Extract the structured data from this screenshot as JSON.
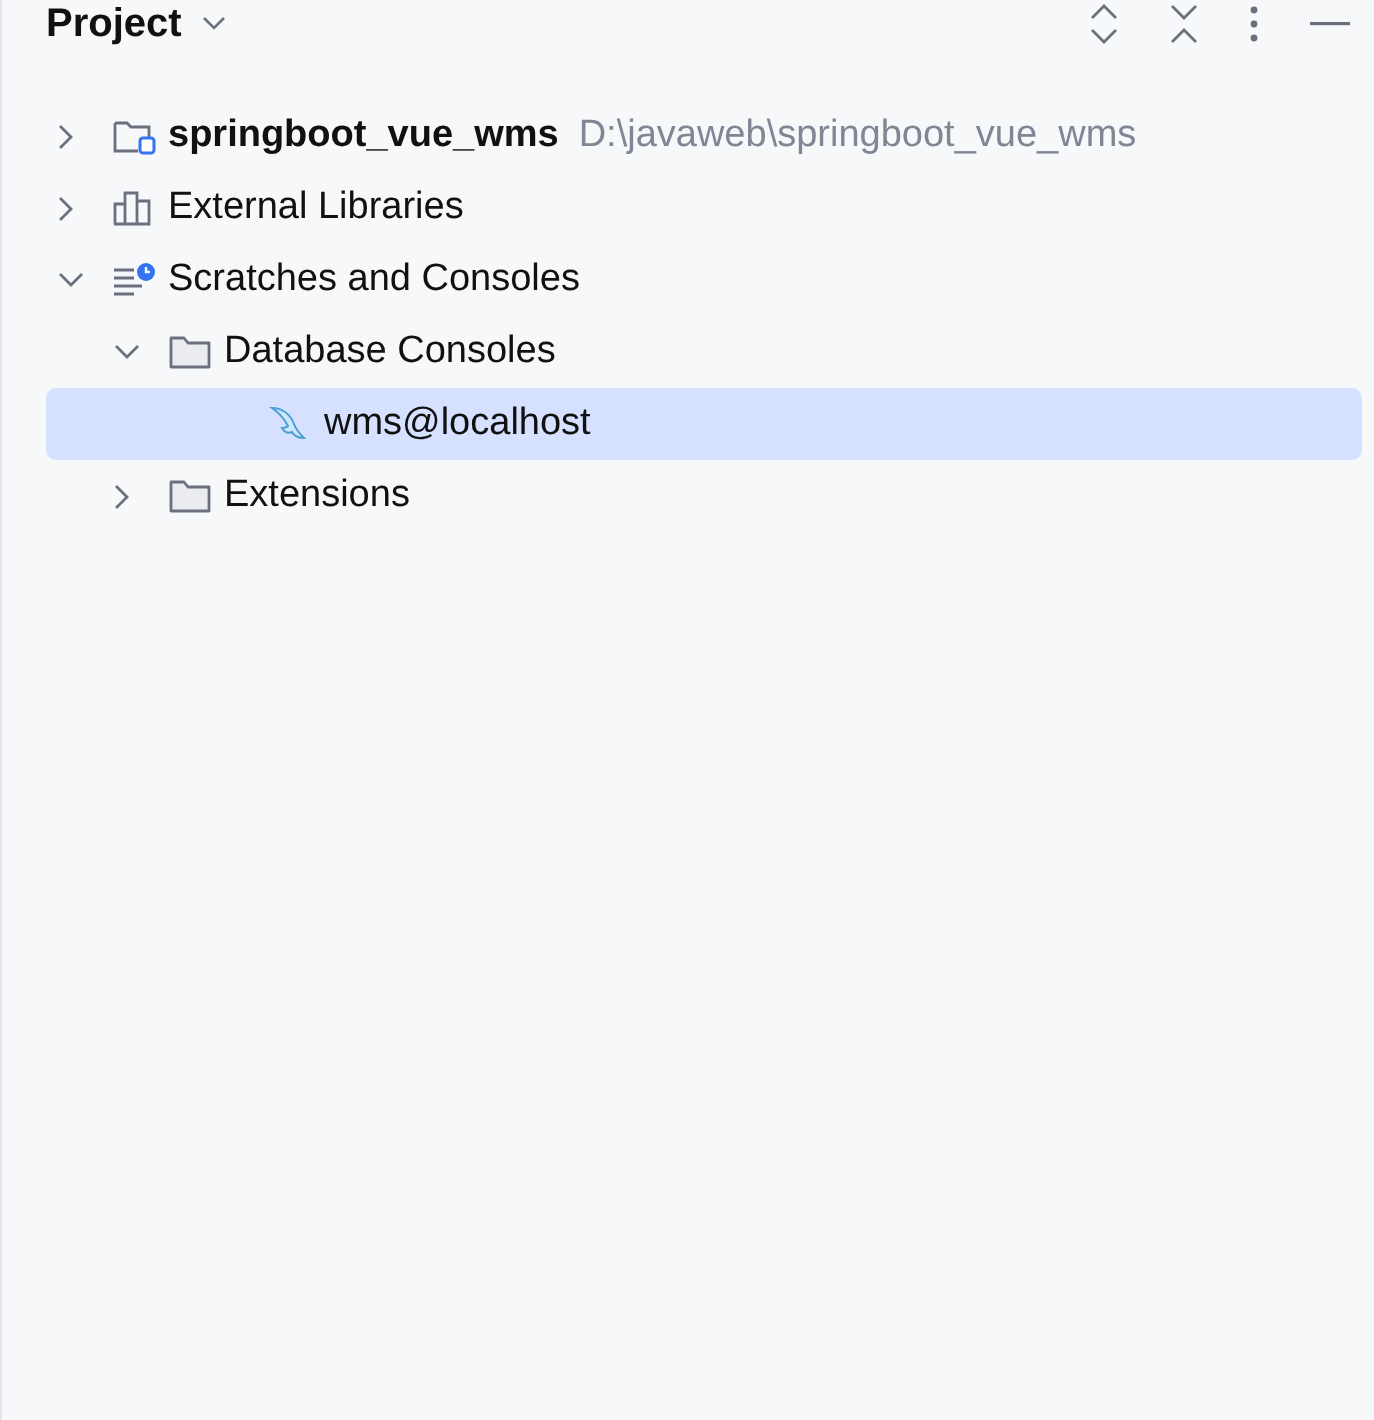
{
  "panel": {
    "title": "Project"
  },
  "tree": [
    {
      "label": "springboot_vue_wms",
      "kind": "module",
      "hint": "D:\\javaweb\\springboot_vue_wms",
      "expanded": false,
      "selected": false
    },
    {
      "label": "External Libraries",
      "kind": "library",
      "expanded": false,
      "selected": false
    },
    {
      "label": "Scratches and Consoles",
      "kind": "scratches",
      "expanded": true,
      "selected": false,
      "children": [
        {
          "label": "Database Consoles",
          "kind": "folder",
          "expanded": true,
          "selected": false,
          "children": [
            {
              "label": "wms@localhost",
              "kind": "database",
              "selected": true
            }
          ]
        },
        {
          "label": "Extensions",
          "kind": "folder",
          "expanded": false,
          "selected": false
        }
      ]
    }
  ]
}
